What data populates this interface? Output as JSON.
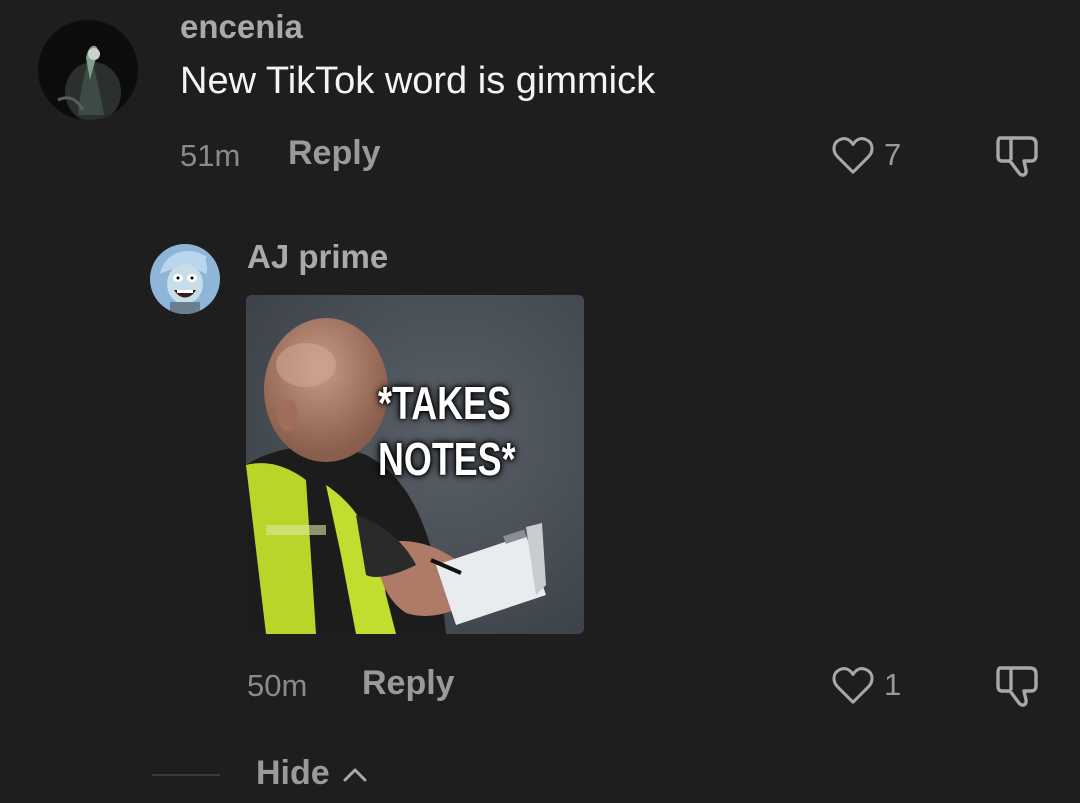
{
  "comments": [
    {
      "username": "encenia",
      "text": "New TikTok word is gimmick",
      "time": "51m",
      "reply_label": "Reply",
      "likes": "7"
    }
  ],
  "replies": [
    {
      "username": "AJ prime",
      "sticker_caption_line1": "*TAKES",
      "sticker_caption_line2": "NOTES*",
      "time": "50m",
      "reply_label": "Reply",
      "likes": "1"
    }
  ],
  "thread_toggle": {
    "label": "Hide",
    "icon": "chevron-up-icon"
  },
  "icons": {
    "like": "heart-outline-icon",
    "dislike": "thumbs-down-icon"
  },
  "colors": {
    "background": "#1e1e1e",
    "username": "#a9a9a9",
    "muted": "#9a9a9a"
  }
}
